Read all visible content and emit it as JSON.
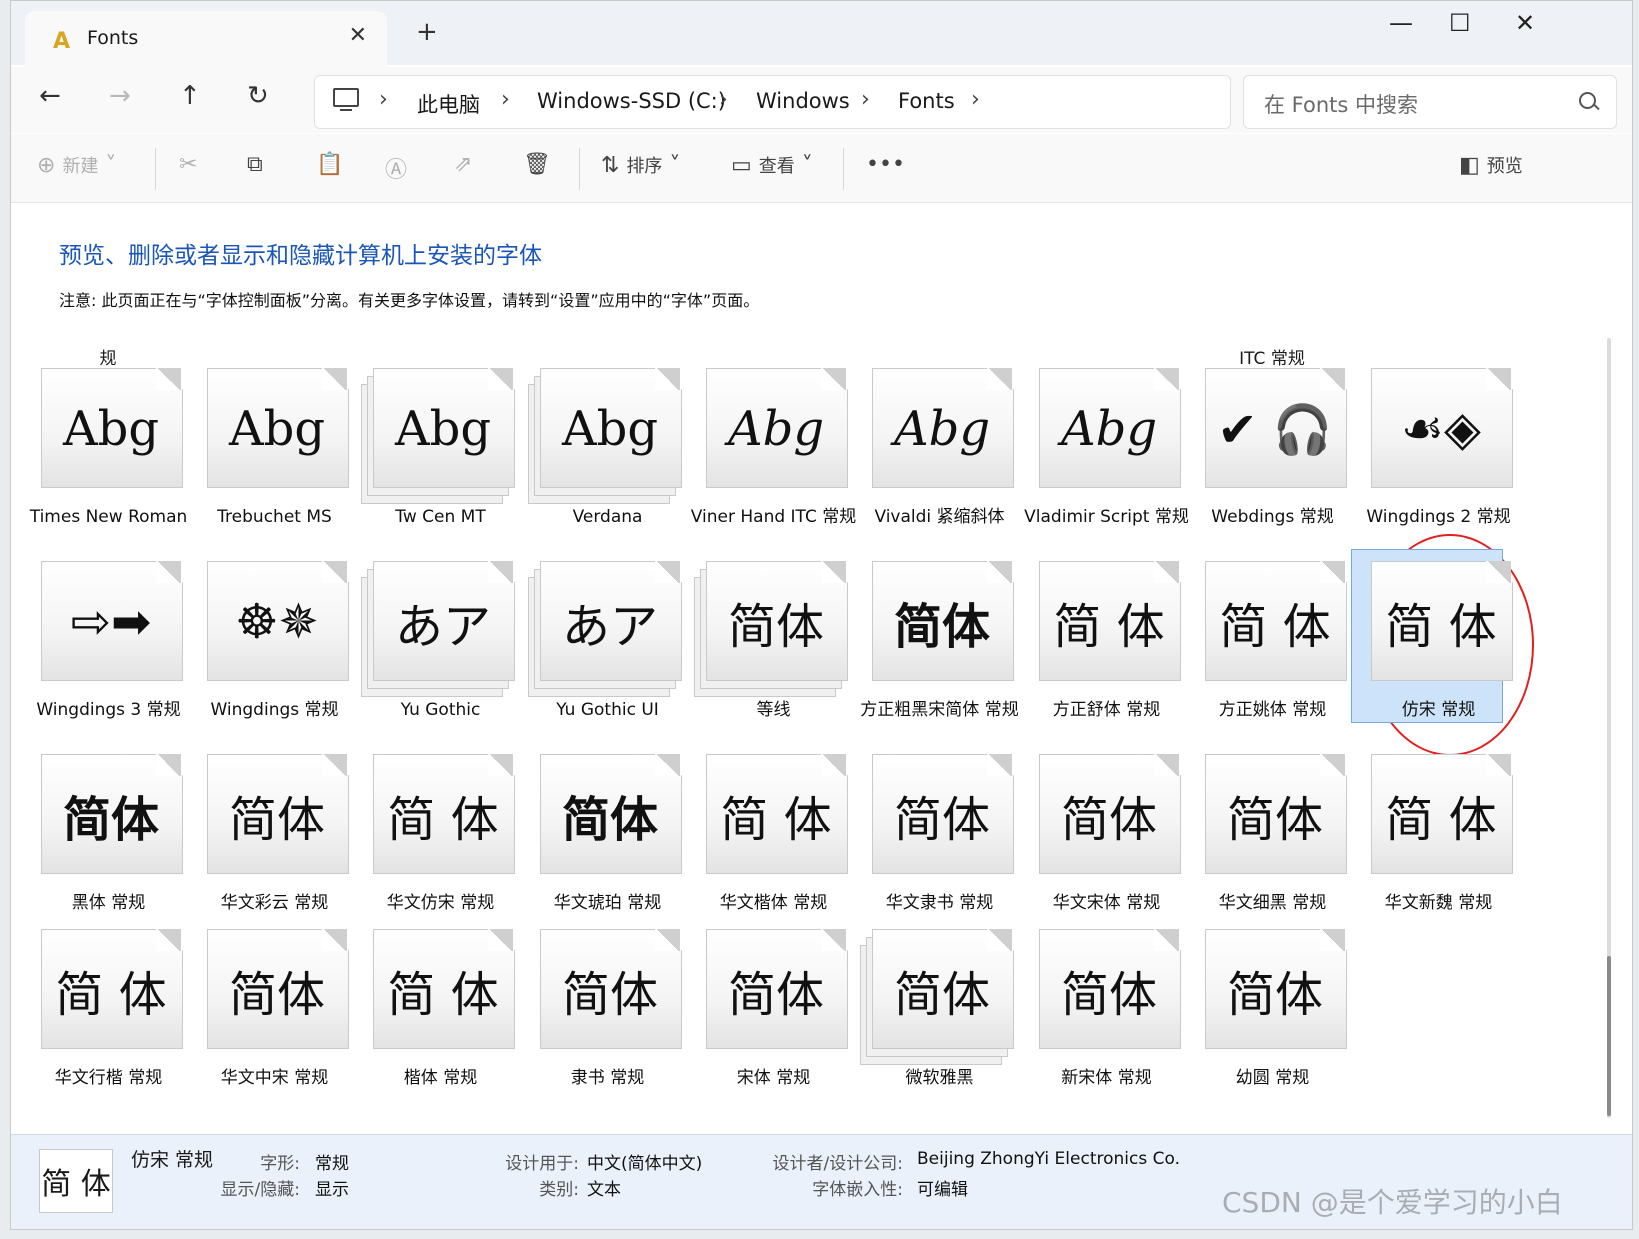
{
  "window": {
    "tab_title": "Fonts",
    "tab_icon": "font-folder-icon",
    "close_tab": "✕",
    "new_tab": "+",
    "minimize": "—",
    "maximize": "☐",
    "close": "✕"
  },
  "nav": {
    "back": "←",
    "forward": "→",
    "up": "↑",
    "refresh": "↻",
    "breadcrumb": [
      "此电脑",
      "Windows-SSD (C:)",
      "Windows",
      "Fonts"
    ],
    "search_placeholder": "在 Fonts 中搜索"
  },
  "toolbar": {
    "new_label": "新建",
    "sort_label": "排序",
    "view_label": "查看",
    "more": "•••",
    "preview_label": "预览"
  },
  "content": {
    "heading": "预览、删除或者显示和隐藏计算机上安装的字体",
    "note": "注意: 此页面正在与“字体控制面板”分离。有关更多字体设置，请转到“设置”应用中的“字体”页面。",
    "partial_captions": [
      "规",
      "ITC 常规"
    ]
  },
  "fonts": [
    {
      "name": "Times New Roman",
      "sample": "Abg"
    },
    {
      "name": "Trebuchet MS",
      "sample": "Abg"
    },
    {
      "name": "Tw Cen MT",
      "sample": "Abg"
    },
    {
      "name": "Verdana",
      "sample": "Abg"
    },
    {
      "name": "Viner Hand ITC 常规",
      "sample": "Abg"
    },
    {
      "name": "Vivaldi 紧缩斜体",
      "sample": "Abg"
    },
    {
      "name": "Vladimir Script 常规",
      "sample": "Abg"
    },
    {
      "name": "Webdings 常规",
      "sample": "✔ 🎧"
    },
    {
      "name": "Wingdings 2 常规",
      "sample": "☙◈"
    },
    {
      "name": "Wingdings 3 常规",
      "sample": "⇨➡"
    },
    {
      "name": "Wingdings 常规",
      "sample": "☸✵"
    },
    {
      "name": "Yu Gothic",
      "sample": "あア"
    },
    {
      "name": "Yu Gothic UI",
      "sample": "あア"
    },
    {
      "name": "等线",
      "sample": "简体"
    },
    {
      "name": "方正粗黑宋简体 常规",
      "sample": "简体"
    },
    {
      "name": "方正舒体 常规",
      "sample": "简 体"
    },
    {
      "name": "方正姚体 常规",
      "sample": "简 体"
    },
    {
      "name": "仿宋 常规",
      "sample": "简 体"
    },
    {
      "name": "黑体 常规",
      "sample": "简体"
    },
    {
      "name": "华文彩云 常规",
      "sample": "简体"
    },
    {
      "name": "华文仿宋 常规",
      "sample": "简 体"
    },
    {
      "name": "华文琥珀 常规",
      "sample": "简体"
    },
    {
      "name": "华文楷体 常规",
      "sample": "简 体"
    },
    {
      "name": "华文隶书 常规",
      "sample": "简体"
    },
    {
      "name": "华文宋体 常规",
      "sample": "简体"
    },
    {
      "name": "华文细黑 常规",
      "sample": "简体"
    },
    {
      "name": "华文新魏 常规",
      "sample": "简 体"
    },
    {
      "name": "华文行楷 常规",
      "sample": "简 体"
    },
    {
      "name": "华文中宋 常规",
      "sample": "简体"
    },
    {
      "name": "楷体 常规",
      "sample": "简 体"
    },
    {
      "name": "隶书 常规",
      "sample": "简体"
    },
    {
      "name": "宋体 常规",
      "sample": "简体"
    },
    {
      "name": "微软雅黑",
      "sample": "简体"
    },
    {
      "name": "新宋体 常规",
      "sample": "简体"
    },
    {
      "name": "幼圆 常规",
      "sample": "简体"
    }
  ],
  "selected_font": "仿宋 常规",
  "details": {
    "thumb": "简 体",
    "name": "仿宋 常规",
    "style_key": "字形:",
    "style_val": "常规",
    "show_key": "显示/隐藏:",
    "show_val": "显示",
    "designed_key": "设计用于:",
    "designed_val": "中文(简体中文)",
    "category_key": "类别:",
    "category_val": "文本",
    "designer_key": "设计者/设计公司:",
    "designer_val": "Beijing ZhongYi Electronics Co.",
    "embed_key": "字体嵌入性:",
    "embed_val": "可编辑"
  },
  "watermark": "CSDN @是个爱学习的小白",
  "colors": {
    "accent": "#1a56b8",
    "selection": "#cde3fa",
    "annotation_circle": "#e31f1f"
  }
}
